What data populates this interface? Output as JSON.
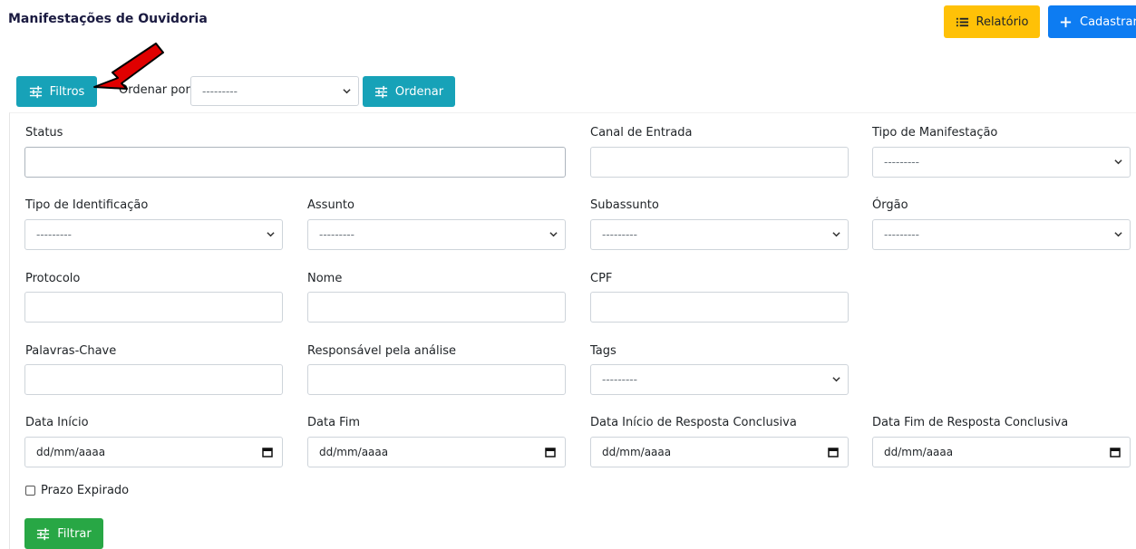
{
  "header": {
    "title": "Manifestações de Ouvidoria",
    "relatorio_label": "Relatório",
    "cadastrar_label": "Cadastrar"
  },
  "toolbar": {
    "filtros_label": "Filtros",
    "ordenar_por_label": "Ordenar por",
    "ordenar_select_value": "---------",
    "ordenar_button_label": "Ordenar"
  },
  "filters": {
    "status": {
      "label": "Status",
      "value": ""
    },
    "canal": {
      "label": "Canal de Entrada",
      "value": ""
    },
    "tipo_manifestacao": {
      "label": "Tipo de Manifestação",
      "value": "---------"
    },
    "tipo_identificacao": {
      "label": "Tipo de Identificação",
      "value": "---------"
    },
    "assunto": {
      "label": "Assunto",
      "value": "---------"
    },
    "subassunto": {
      "label": "Subassunto",
      "value": "---------"
    },
    "orgao": {
      "label": "Órgão",
      "value": "---------"
    },
    "protocolo": {
      "label": "Protocolo",
      "value": ""
    },
    "nome": {
      "label": "Nome",
      "value": ""
    },
    "cpf": {
      "label": "CPF",
      "value": ""
    },
    "palavras_chave": {
      "label": "Palavras-Chave",
      "value": ""
    },
    "responsavel": {
      "label": "Responsável pela análise",
      "value": ""
    },
    "tags": {
      "label": "Tags",
      "value": "---------"
    },
    "data_inicio": {
      "label": "Data Início",
      "value": "dd/mm/aaaa"
    },
    "data_fim": {
      "label": "Data Fim",
      "value": "dd/mm/aaaa"
    },
    "data_inicio_resposta": {
      "label": "Data Início de Resposta Conclusiva",
      "value": "dd/mm/aaaa"
    },
    "data_fim_resposta": {
      "label": "Data Fim de Resposta Conclusiva",
      "value": "dd/mm/aaaa"
    },
    "prazo_expirado": {
      "label": "Prazo Expirado",
      "checked": false
    },
    "filtrar_label": "Filtrar"
  },
  "colors": {
    "warning": "#ffc107",
    "primary": "#0d7cf2",
    "info": "#17a2b8",
    "success": "#28a745",
    "arrow": "#e00000"
  },
  "icons": {
    "relatorio": "list-icon",
    "cadastrar": "plus-icon",
    "filtros": "sliders-icon",
    "ordenar": "sliders-icon",
    "filtrar": "sliders-icon",
    "select": "chevron-down-icon",
    "date": "calendar-icon",
    "annotation": "red-arrow-icon"
  }
}
